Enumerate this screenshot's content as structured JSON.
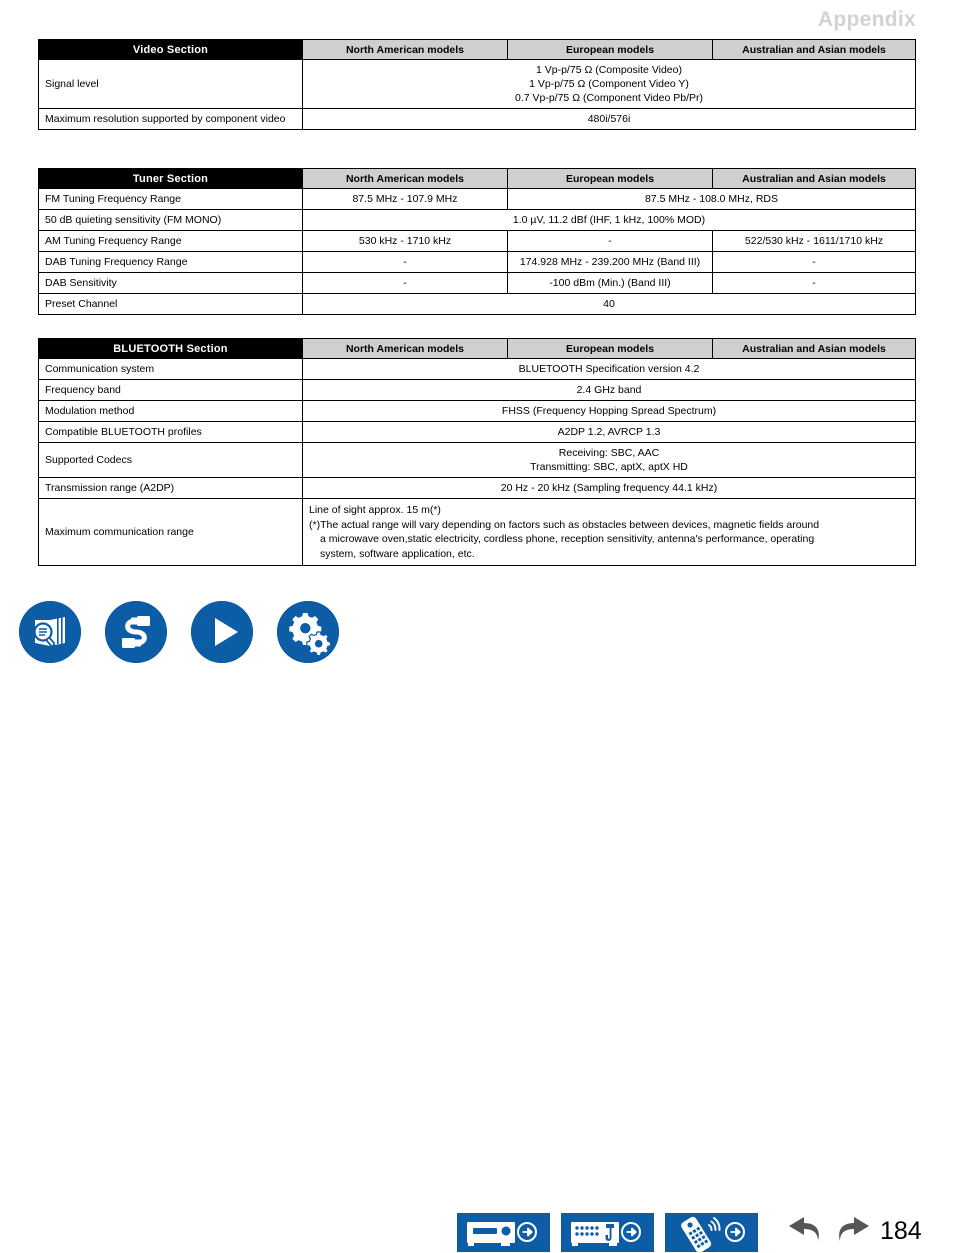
{
  "header": {
    "title": "Appendix"
  },
  "common_columns": {
    "north_american": "North American models",
    "european": "European models",
    "australian_asian": "Australian and Asian models"
  },
  "tables": {
    "video": {
      "section_title": "Video Section",
      "rows": {
        "signal_level": {
          "label": "Signal level",
          "line1": "1 Vp-p/75 Ω (Composite Video)",
          "line2": "1 Vp-p/75 Ω (Component Video Y)",
          "line3": "0.7 Vp-p/75 Ω (Component Video Pb/Pr)"
        },
        "max_resolution": {
          "label": "Maximum resolution supported by component video",
          "value": "480i/576i"
        }
      }
    },
    "tuner": {
      "section_title": "Tuner Section",
      "rows": {
        "fm_range": {
          "label": "FM Tuning Frequency Range",
          "na": "87.5 MHz - 107.9 MHz",
          "eu_au": "87.5 MHz - 108.0 MHz, RDS"
        },
        "quieting": {
          "label": "50 dB quieting sensitivity (FM MONO)",
          "value": "1.0 µV, 11.2 dBf (IHF, 1 kHz, 100% MOD)"
        },
        "am_range": {
          "label": "AM Tuning Frequency Range",
          "na": "530 kHz - 1710 kHz",
          "eu": "-",
          "au": "522/530 kHz - 1611/1710 kHz"
        },
        "dab_range": {
          "label": "DAB Tuning Frequency Range",
          "na": "-",
          "eu": "174.928 MHz - 239.200 MHz (Band III)",
          "au": "-"
        },
        "dab_sensitivity": {
          "label": "DAB Sensitivity",
          "na": "-",
          "eu": "-100 dBm (Min.) (Band III)",
          "au": "-"
        },
        "preset_channel": {
          "label": "Preset Channel",
          "value": "40"
        }
      }
    },
    "bluetooth": {
      "section_title": "BLUETOOTH Section",
      "rows": {
        "comm_system": {
          "label": "Communication system",
          "value": "BLUETOOTH Specification version 4.2"
        },
        "frequency_band": {
          "label": "Frequency band",
          "value": "2.4 GHz band"
        },
        "modulation": {
          "label": "Modulation method",
          "value": "FHSS (Frequency Hopping Spread Spectrum)"
        },
        "profiles": {
          "label": "Compatible BLUETOOTH profiles",
          "value": "A2DP 1.2, AVRCP 1.3"
        },
        "codecs": {
          "label": "Supported Codecs",
          "line1": "Receiving: SBC, AAC",
          "line2": "Transmitting: SBC, aptX, aptX HD"
        },
        "transmission_range": {
          "label": "Transmission range (A2DP)",
          "value": "20 Hz - 20 kHz (Sampling frequency 44.1 kHz)"
        },
        "max_comm_range": {
          "label": "Maximum communication range",
          "line1": "Line of sight approx. 15 m(*)",
          "line2": "(*)The actual range will vary depending on factors such as obstacles between devices, magnetic fields around",
          "line3": "a microwave oven,static electricity, cordless phone, reception sensitivity, antenna's performance, operating",
          "line4": "system, software application, etc."
        }
      }
    }
  },
  "footer": {
    "buttons": [
      {
        "name": "reference-icon",
        "title": "Reference"
      },
      {
        "name": "connections-icon",
        "title": "Connections"
      },
      {
        "name": "playback-icon",
        "title": "Playback"
      },
      {
        "name": "setup-icon",
        "title": "Setup"
      },
      {
        "name": "front-panel-icon",
        "title": "Front Panel"
      },
      {
        "name": "rear-panel-icon",
        "title": "Rear Panel"
      },
      {
        "name": "remote-control-icon",
        "title": "Remote Controller"
      },
      {
        "name": "back-arrow-icon",
        "title": "Back"
      },
      {
        "name": "forward-arrow-icon",
        "title": "Forward"
      }
    ],
    "page_number": "184"
  },
  "colors": {
    "accent_blue": "#0d5ca6",
    "header_gray": "#cfcfcf",
    "title_gray": "#d2d2d2",
    "section_black": "#000000"
  }
}
